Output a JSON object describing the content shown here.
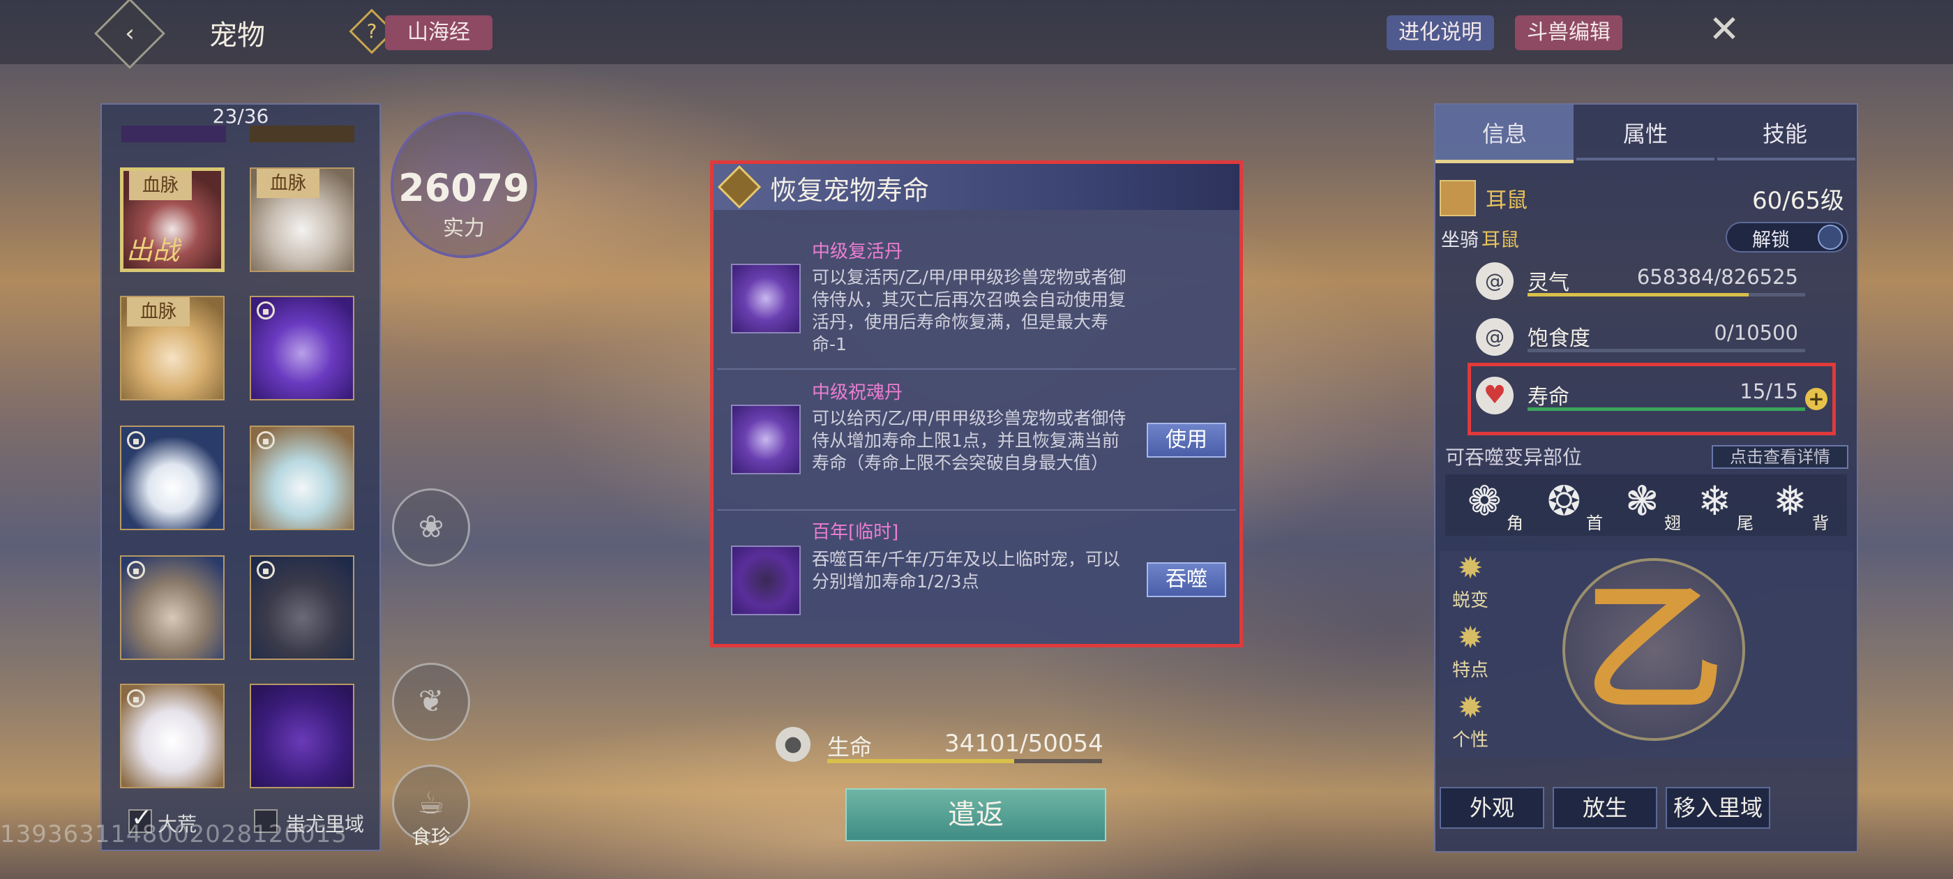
{
  "topbar": {
    "back_icon": "back-arrow-icon",
    "title": "宠物",
    "help_icon": "question-icon",
    "shanhai_label": "山海经",
    "evolution_label": "进化说明",
    "edit_label": "斗兽编辑",
    "close_icon": "close-x-icon"
  },
  "pet_list": {
    "count": "23/36",
    "blood_label": "血脉",
    "deploy_label": "出战",
    "filters": [
      {
        "label": "大荒",
        "checked": true
      },
      {
        "label": "蚩尤里域",
        "checked": false
      }
    ]
  },
  "watermark": "1393631148002028120013",
  "power": {
    "value": "26079",
    "label": "实力"
  },
  "side_actions": {
    "shizhen_label": "食珍"
  },
  "dialog": {
    "title": "恢复宠物寿命",
    "items": [
      {
        "name": "中级复活丹",
        "desc_lines": [
          "可以复活丙/乙/甲/甲甲级珍兽宠物或者御",
          "侍侍从，其灭亡后再次召唤会自动使用复",
          "活丹，使用后寿命恢复满，但是最大寿",
          "命-1"
        ],
        "button": ""
      },
      {
        "name": "中级祝魂丹",
        "desc_lines": [
          "可以给丙/乙/甲/甲甲级珍兽宠物或者御侍",
          "侍从增加寿命上限1点，并且恢复满当前",
          "寿命（寿命上限不会突破自身最大值）"
        ],
        "button": "使用"
      },
      {
        "name": "百年[临时]",
        "desc_lines": [
          "吞噬百年/千年/万年及以上临时宠，可以",
          "分别增加寿命1/2/3点"
        ],
        "button": "吞噬"
      }
    ]
  },
  "life": {
    "label": "生命",
    "value": "34101/50054",
    "current": 34101,
    "max": 50054
  },
  "return_label": "遣返",
  "info_panel": {
    "tabs": [
      "信息",
      "属性",
      "技能"
    ],
    "active_tab": "信息",
    "pet_name": "耳鼠",
    "level": "60/65级",
    "mount_label": "坐骑",
    "mount_name": "耳鼠",
    "unlock_label": "解锁",
    "stats": [
      {
        "label": "灵气",
        "value": "658384/826525",
        "current": 658384,
        "max": 826525,
        "color": "#d8c04a",
        "icon": "spirit-swirl-icon"
      },
      {
        "label": "饱食度",
        "value": "0/10500",
        "current": 0,
        "max": 10500,
        "color": "#d8c04a",
        "icon": "stomach-icon"
      },
      {
        "label": "寿命",
        "value": "15/15",
        "current": 15,
        "max": 15,
        "color": "#3aa55a",
        "icon": "heart-icon"
      }
    ],
    "mutate_label": "可吞噬变异部位",
    "detail_label": "点击查看详情",
    "parts": [
      "角",
      "首",
      "翅",
      "尾",
      "背"
    ],
    "traits": [
      "蜕变",
      "特点",
      "个性"
    ],
    "grade_char": "乙",
    "buttons": [
      "外观",
      "放生",
      "移入里域"
    ]
  }
}
